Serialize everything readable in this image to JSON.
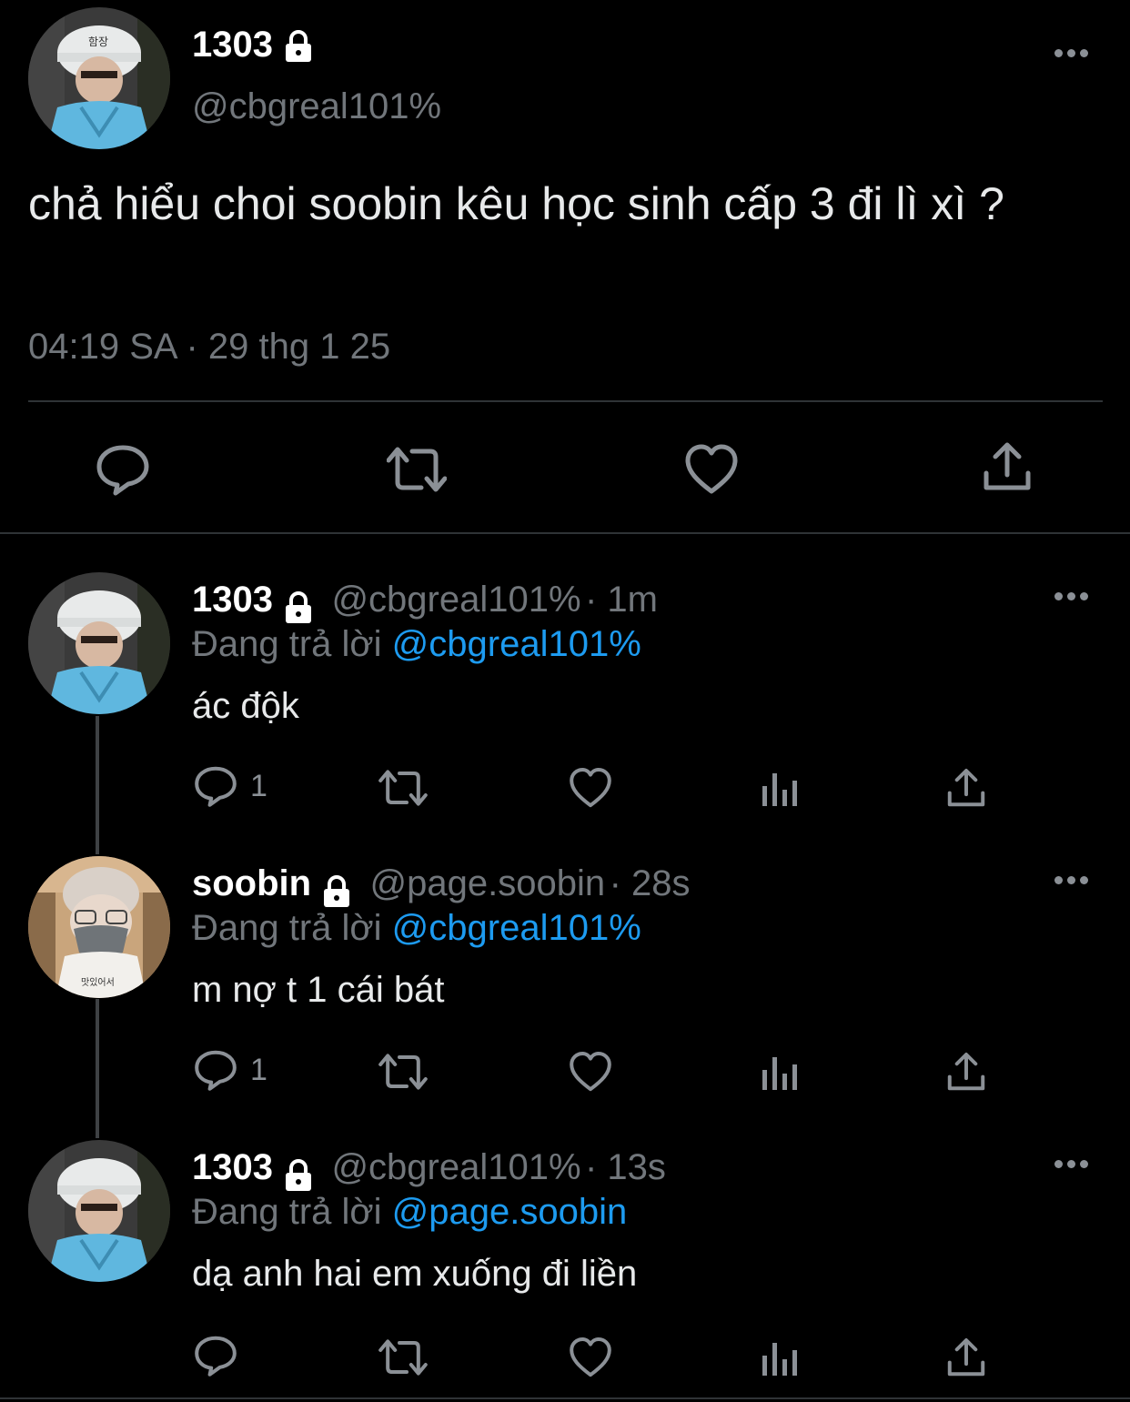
{
  "main_tweet": {
    "display_name": "1303",
    "handle": "@cbgreal101%",
    "text": "chả hiểu choi soobin kêu học sinh cấp 3 đi lì xì ?",
    "timestamp": "04:19 SA · 29 thg 1 25",
    "actions": [
      "reply-icon",
      "retweet-icon",
      "like-icon",
      "share-icon"
    ]
  },
  "replies": [
    {
      "display_name": "1303",
      "handle": "@cbgreal101%",
      "time": "· 1m",
      "replying_prefix": "Đang trả lời",
      "replying_to": "@cbgreal101%",
      "text": "ác độk",
      "reply_count": "1"
    },
    {
      "display_name": "soobin",
      "handle": "@page.soobin",
      "time": "· 28s",
      "replying_prefix": "Đang trả lời",
      "replying_to": "@cbgreal101%",
      "text": "m nợ t 1 cái bát",
      "reply_count": "1"
    },
    {
      "display_name": "1303",
      "handle": "@cbgreal101%",
      "time": "· 13s",
      "replying_prefix": "Đang trả lời",
      "replying_to": "@page.soobin",
      "text": "dạ anh hai em xuống đi liền",
      "reply_count": ""
    }
  ],
  "colors": {
    "background": "#000000",
    "text": "#e7e9ea",
    "secondary": "#71767b",
    "link": "#1d9bf0",
    "divider": "#2f3336"
  }
}
